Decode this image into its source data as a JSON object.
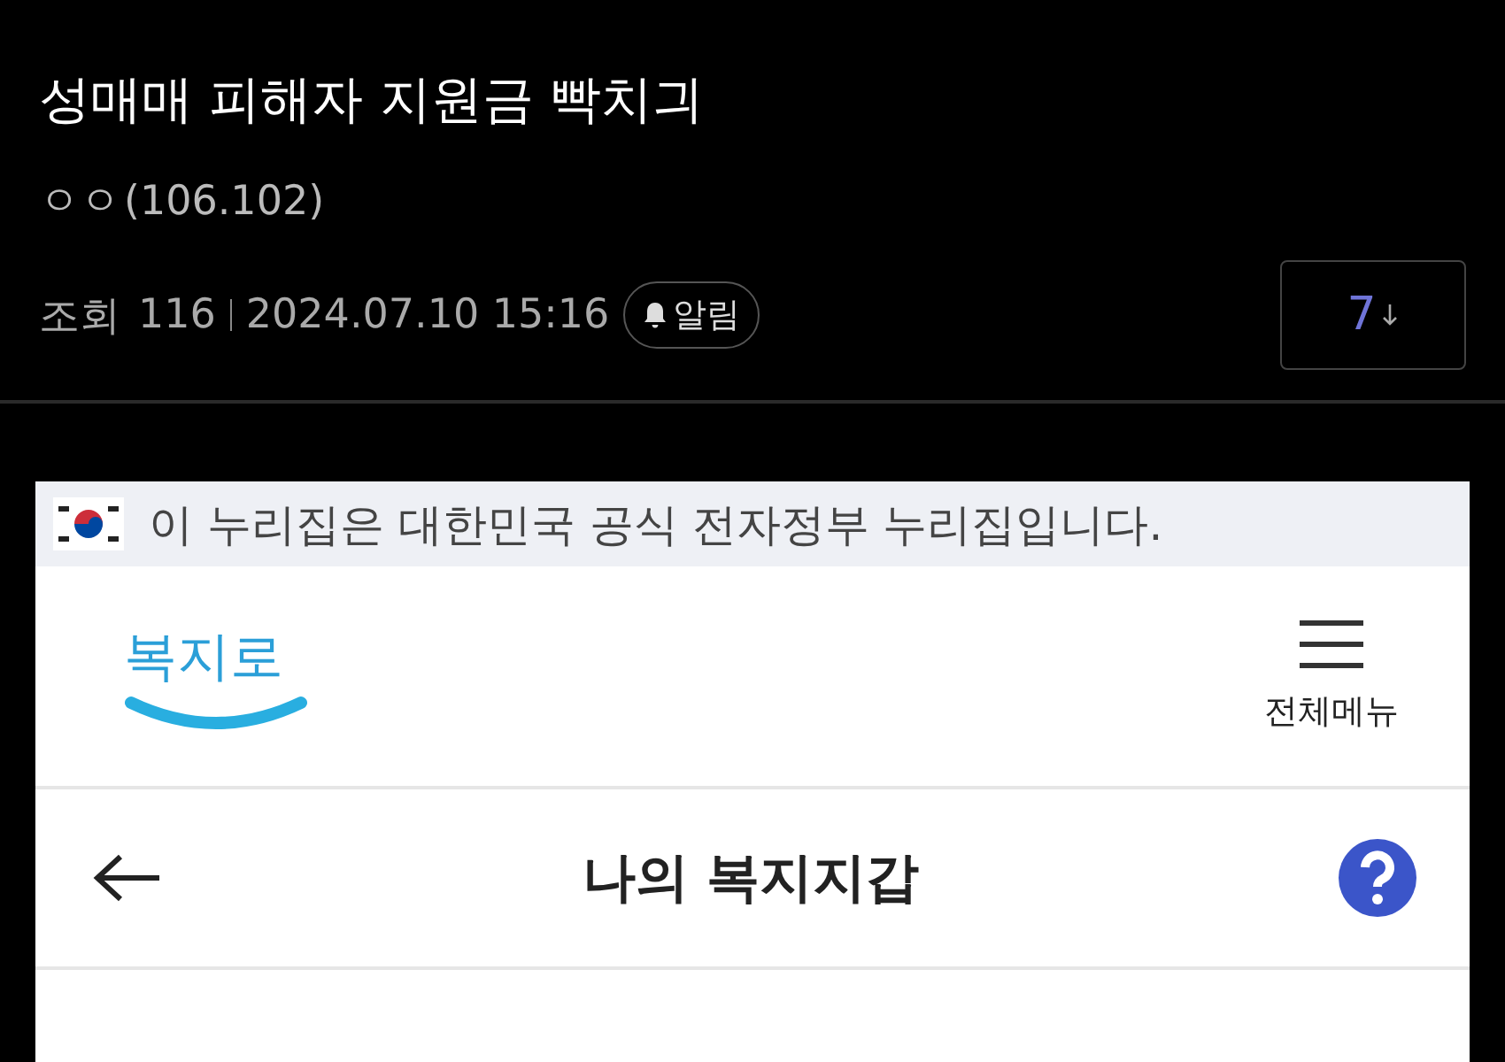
{
  "post": {
    "title": "성매매 피해자 지원금 빡치긔",
    "author": "ㅇㅇ",
    "author_ip": "(106.102)",
    "views_label": "조회",
    "views": "116",
    "date": "2024.07.10 15:16",
    "alarm_button": "알림",
    "comment_count": "7"
  },
  "embedded_screenshot": {
    "banner": "이 누리집은 대한민국 공식 전자정부 누리집입니다.",
    "logo": "복지로",
    "menu_label": "전체메뉴",
    "page_title": "나의 복지지갑"
  }
}
